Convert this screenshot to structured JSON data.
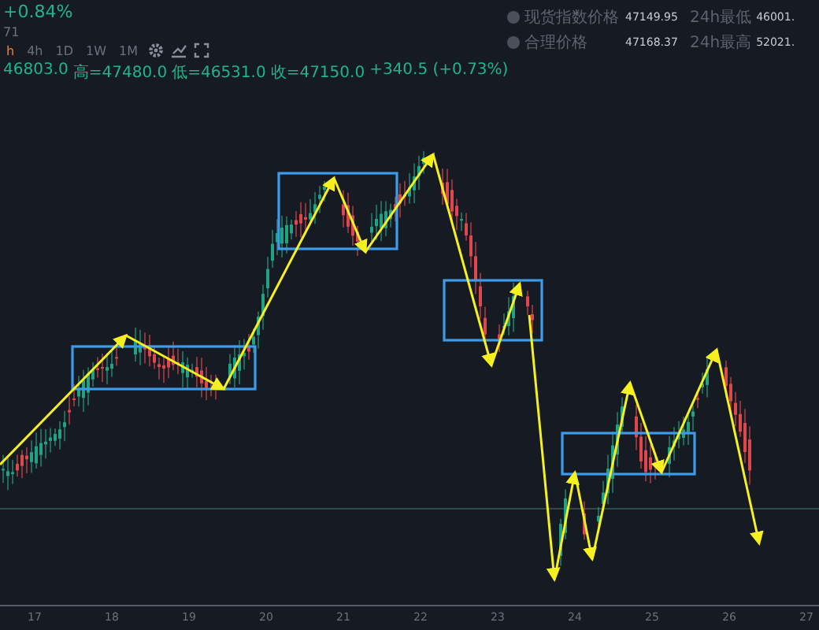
{
  "header": {
    "change": "+0.84%",
    "subtitle": "71",
    "timeframes": [
      {
        "label": "h",
        "selected": true
      },
      {
        "label": "4h",
        "selected": false
      },
      {
        "label": "1D",
        "selected": false
      },
      {
        "label": "1W",
        "selected": false
      },
      {
        "label": "1M",
        "selected": false
      }
    ],
    "ohlc": [
      "46803.0",
      "高=47480.0",
      "低=46531.0",
      "收=47150.0",
      "+340.5 (+0.73%)"
    ]
  },
  "stats": [
    {
      "label": "现货指数价格",
      "value": "47149.95",
      "range_label": "24h最低",
      "range_value": "46001."
    },
    {
      "label": "合理价格",
      "value": "47168.37",
      "range_label": "24h最高",
      "range_value": "52021."
    }
  ],
  "chart": {
    "x_labels": [
      "17",
      "18",
      "19",
      "20",
      "21",
      "22",
      "23",
      "24",
      "25",
      "26",
      "27"
    ]
  }
}
